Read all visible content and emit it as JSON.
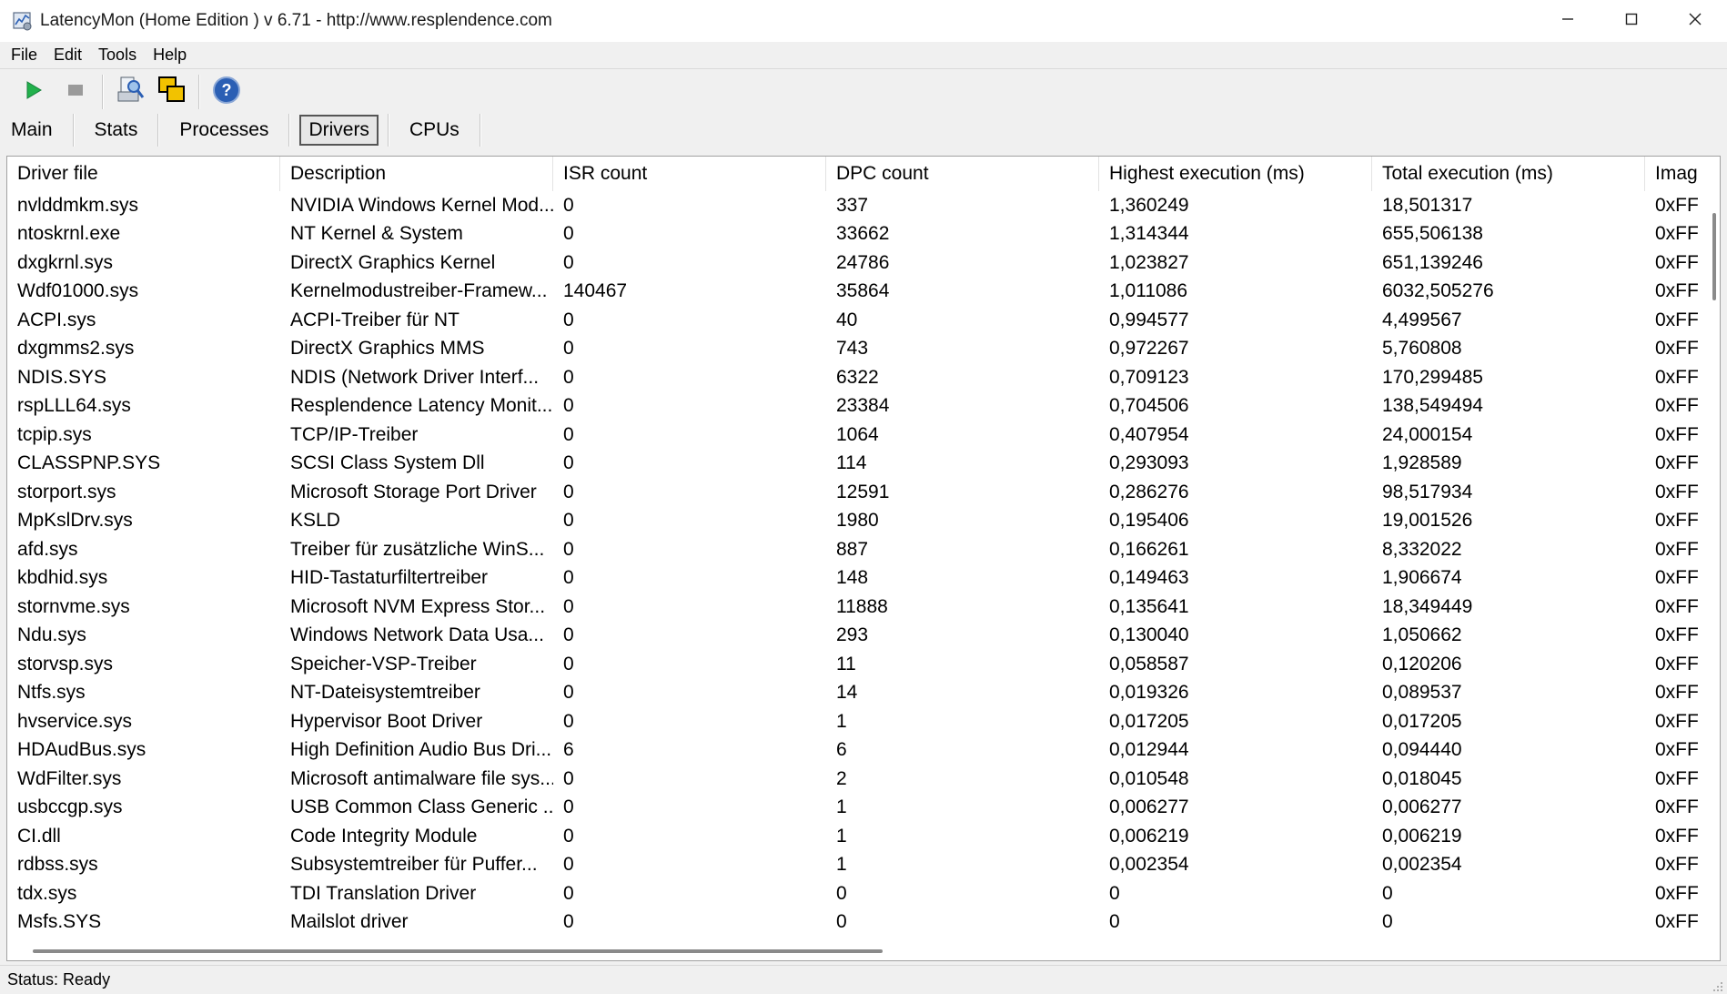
{
  "window": {
    "title": "LatencyMon  (Home Edition )  v 6.71 - http://www.resplendence.com",
    "icon": "latencymon-app-icon",
    "controls": [
      "minimize-icon",
      "maximize-icon",
      "close-icon"
    ]
  },
  "menu": [
    {
      "label": "File"
    },
    {
      "label": "Edit"
    },
    {
      "label": "Tools"
    },
    {
      "label": "Help"
    }
  ],
  "toolbar": {
    "buttons": [
      {
        "name": "start-monitoring",
        "icon": "play-icon",
        "color": "#22b14c"
      },
      {
        "name": "stop-monitoring",
        "icon": "stop-icon",
        "color": "#9a9a9a"
      },
      {
        "name": "analyze",
        "icon": "inspect-icon"
      },
      {
        "name": "copy",
        "icon": "copy-windows-icon",
        "color": "#f2c200"
      },
      {
        "name": "help",
        "icon": "help-icon",
        "color": "#2b5fb4"
      }
    ]
  },
  "tabs": [
    {
      "label": "Main",
      "active": false
    },
    {
      "label": "Stats",
      "active": false
    },
    {
      "label": "Processes",
      "active": false
    },
    {
      "label": "Drivers",
      "active": true
    },
    {
      "label": "CPUs",
      "active": false
    }
  ],
  "table": {
    "columns": [
      "Driver file",
      "Description",
      "ISR count",
      "DPC count",
      "Highest execution (ms)",
      "Total execution (ms)",
      "Imag"
    ],
    "rows": [
      [
        "nvlddmkm.sys",
        "NVIDIA Windows Kernel Mod...",
        "0",
        "337",
        "1,360249",
        "18,501317",
        "0xFF"
      ],
      [
        "ntoskrnl.exe",
        "NT Kernel & System",
        "0",
        "33662",
        "1,314344",
        "655,506138",
        "0xFF"
      ],
      [
        "dxgkrnl.sys",
        "DirectX Graphics Kernel",
        "0",
        "24786",
        "1,023827",
        "651,139246",
        "0xFF"
      ],
      [
        "Wdf01000.sys",
        "Kernelmodustreiber-Framew...",
        "140467",
        "35864",
        "1,011086",
        "6032,505276",
        "0xFF"
      ],
      [
        "ACPI.sys",
        "ACPI-Treiber für NT",
        "0",
        "40",
        "0,994577",
        "4,499567",
        "0xFF"
      ],
      [
        "dxgmms2.sys",
        "DirectX Graphics MMS",
        "0",
        "743",
        "0,972267",
        "5,760808",
        "0xFF"
      ],
      [
        "NDIS.SYS",
        "NDIS (Network Driver Interf...",
        "0",
        "6322",
        "0,709123",
        "170,299485",
        "0xFF"
      ],
      [
        "rspLLL64.sys",
        "Resplendence Latency Monit...",
        "0",
        "23384",
        "0,704506",
        "138,549494",
        "0xFF"
      ],
      [
        "tcpip.sys",
        "TCP/IP-Treiber",
        "0",
        "1064",
        "0,407954",
        "24,000154",
        "0xFF"
      ],
      [
        "CLASSPNP.SYS",
        "SCSI Class System Dll",
        "0",
        "114",
        "0,293093",
        "1,928589",
        "0xFF"
      ],
      [
        "storport.sys",
        "Microsoft Storage Port Driver",
        "0",
        "12591",
        "0,286276",
        "98,517934",
        "0xFF"
      ],
      [
        "MpKslDrv.sys",
        "KSLD",
        "0",
        "1980",
        "0,195406",
        "19,001526",
        "0xFF"
      ],
      [
        "afd.sys",
        "Treiber für zusätzliche WinS...",
        "0",
        "887",
        "0,166261",
        "8,332022",
        "0xFF"
      ],
      [
        "kbdhid.sys",
        "HID-Tastaturfiltertreiber",
        "0",
        "148",
        "0,149463",
        "1,906674",
        "0xFF"
      ],
      [
        "stornvme.sys",
        "Microsoft NVM Express Stor...",
        "0",
        "11888",
        "0,135641",
        "18,349449",
        "0xFF"
      ],
      [
        "Ndu.sys",
        "Windows Network Data Usa...",
        "0",
        "293",
        "0,130040",
        "1,050662",
        "0xFF"
      ],
      [
        "storvsp.sys",
        "Speicher-VSP-Treiber",
        "0",
        "11",
        "0,058587",
        "0,120206",
        "0xFF"
      ],
      [
        "Ntfs.sys",
        "NT-Dateisystemtreiber",
        "0",
        "14",
        "0,019326",
        "0,089537",
        "0xFF"
      ],
      [
        "hvservice.sys",
        "Hypervisor Boot Driver",
        "0",
        "1",
        "0,017205",
        "0,017205",
        "0xFF"
      ],
      [
        "HDAudBus.sys",
        "High Definition Audio Bus Dri...",
        "6",
        "6",
        "0,012944",
        "0,094440",
        "0xFF"
      ],
      [
        "WdFilter.sys",
        "Microsoft antimalware file sys...",
        "0",
        "2",
        "0,010548",
        "0,018045",
        "0xFF"
      ],
      [
        "usbccgp.sys",
        "USB Common Class Generic ...",
        "0",
        "1",
        "0,006277",
        "0,006277",
        "0xFF"
      ],
      [
        "CI.dll",
        "Code Integrity Module",
        "0",
        "1",
        "0,006219",
        "0,006219",
        "0xFF"
      ],
      [
        "rdbss.sys",
        "Subsystemtreiber für Puffer...",
        "0",
        "1",
        "0,002354",
        "0,002354",
        "0xFF"
      ],
      [
        "tdx.sys",
        "TDI Translation Driver",
        "0",
        "0",
        "0",
        "0",
        "0xFF"
      ],
      [
        "Msfs.SYS",
        "Mailslot driver",
        "0",
        "0",
        "0",
        "0",
        "0xFF"
      ]
    ]
  },
  "status": {
    "text": "Status: Ready"
  }
}
